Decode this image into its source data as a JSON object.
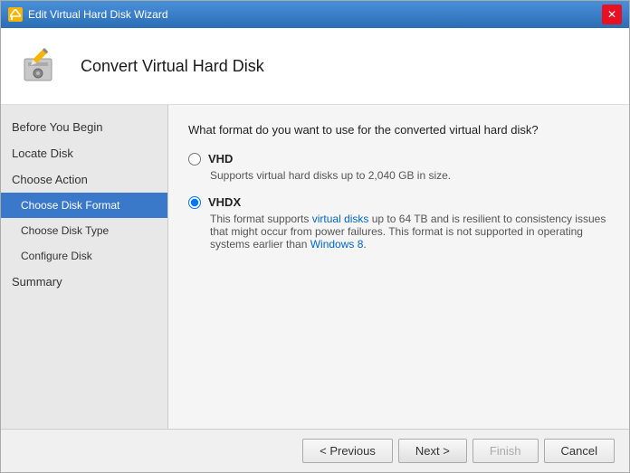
{
  "window": {
    "title": "Edit Virtual Hard Disk Wizard",
    "close_label": "✕"
  },
  "header": {
    "title": "Convert Virtual Hard Disk"
  },
  "sidebar": {
    "items": [
      {
        "label": "Before You Begin",
        "state": "normal",
        "sub": false
      },
      {
        "label": "Locate Disk",
        "state": "normal",
        "sub": false
      },
      {
        "label": "Choose Action",
        "state": "normal",
        "sub": false
      },
      {
        "label": "Choose Disk Format",
        "state": "active",
        "sub": true
      },
      {
        "label": "Choose Disk Type",
        "state": "normal",
        "sub": true
      },
      {
        "label": "Configure Disk",
        "state": "normal",
        "sub": true
      },
      {
        "label": "Summary",
        "state": "normal",
        "sub": false
      }
    ]
  },
  "content": {
    "question": "What format do you want to use for the converted virtual hard disk?",
    "options": [
      {
        "id": "vhd",
        "label": "VHD",
        "description": "Supports virtual hard disks up to 2,040 GB in size.",
        "selected": false
      },
      {
        "id": "vhdx",
        "label": "VHDX",
        "description": "This format supports virtual disks up to 64 TB and is resilient to consistency issues that might occur from power failures. This format is not supported in operating systems earlier than Windows 8.",
        "selected": true
      }
    ]
  },
  "footer": {
    "previous_label": "< Previous",
    "next_label": "Next >",
    "finish_label": "Finish",
    "cancel_label": "Cancel"
  },
  "colors": {
    "active_sidebar": "#3a78c9",
    "accent": "#2a6db5",
    "link": "#0066cc"
  }
}
